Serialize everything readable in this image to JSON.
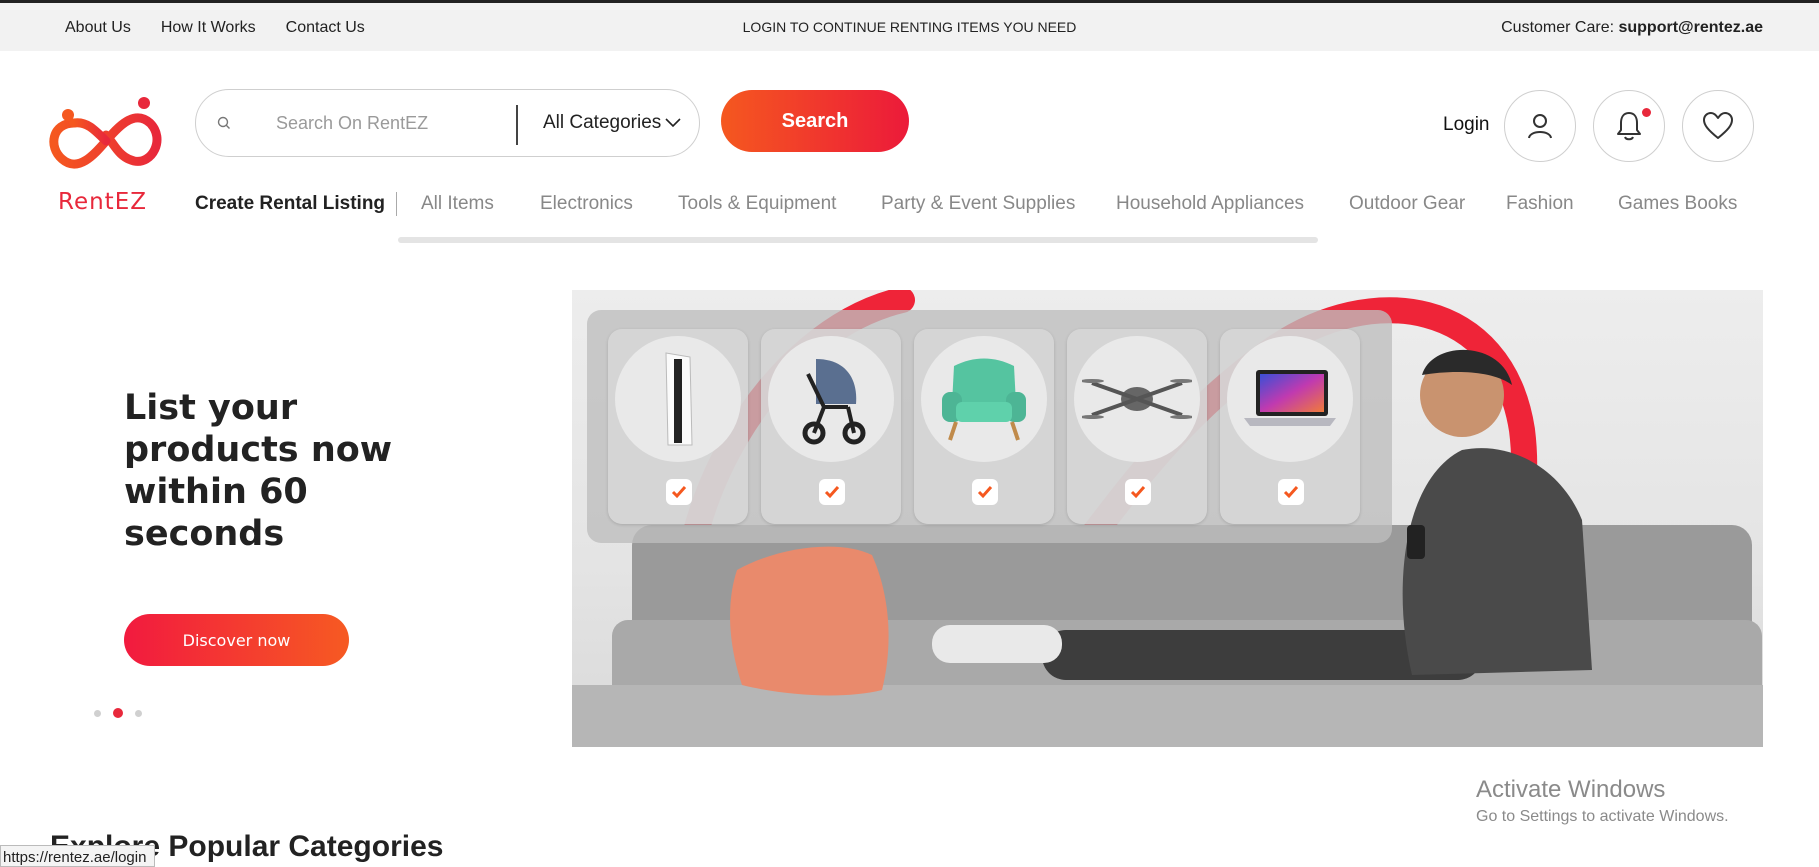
{
  "topbar": {
    "links": [
      "About Us",
      "How It Works",
      "Contact Us"
    ],
    "center_message": "LOGIN TO CONTINUE RENTING ITEMS YOU NEED",
    "care_label": "Customer Care:",
    "care_email": "support@rentez.ae"
  },
  "brand": {
    "name": "RentEZ",
    "color": "#e8283b",
    "accent": "#f5581f"
  },
  "search": {
    "placeholder": "Search On RentEZ",
    "category": "All Categories",
    "button_label": "Search"
  },
  "header_actions": {
    "login_label": "Login",
    "icons": [
      "user-icon",
      "bell-icon",
      "heart-icon"
    ]
  },
  "nav": {
    "create_listing": "Create Rental Listing",
    "categories": [
      "All Items",
      "Electronics",
      "Tools & Equipment",
      "Party & Event Supplies",
      "Household Appliances",
      "Outdoor Gear",
      "Fashion",
      "Games Books"
    ]
  },
  "hero": {
    "title": "List your products now within 60 seconds",
    "cta": "Discover now",
    "slides": 3,
    "active_slide": 2,
    "products": [
      "game-console",
      "stroller",
      "armchair",
      "drone",
      "laptop"
    ]
  },
  "section": {
    "title": "Explore Popular Categories"
  },
  "os_watermark": {
    "title": "Activate Windows",
    "subtitle": "Go to Settings to activate Windows."
  },
  "status_bar": {
    "url": "https://rentez.ae/login"
  }
}
